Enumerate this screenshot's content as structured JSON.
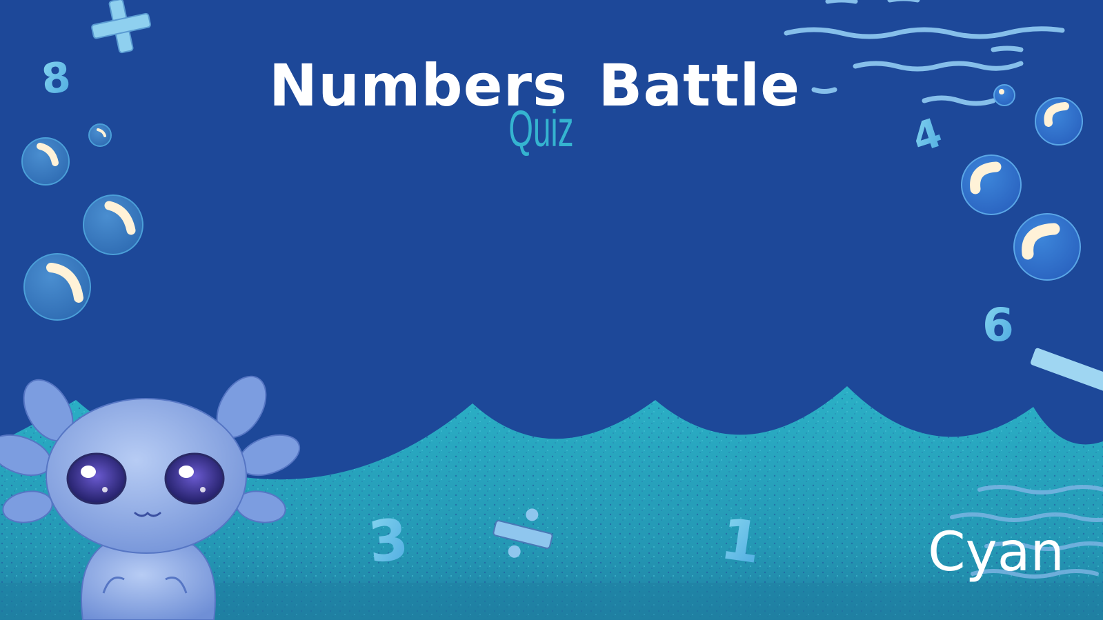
{
  "game": {
    "title": "Numbers Battle",
    "subtitle": "Quiz",
    "player_name": "Cyan"
  },
  "decorations": {
    "digits": [
      "8",
      "4",
      "6",
      "3",
      "1"
    ],
    "operators": [
      "plus-icon",
      "minus-icon",
      "divide-icon"
    ],
    "mascot": "axolotl-mascot"
  },
  "colors": {
    "background": "#1d4899",
    "seabed": "#2aa8c2",
    "subtitle": "#35b4d0",
    "bubble": "#3f86d6",
    "text": "#ffffff"
  }
}
